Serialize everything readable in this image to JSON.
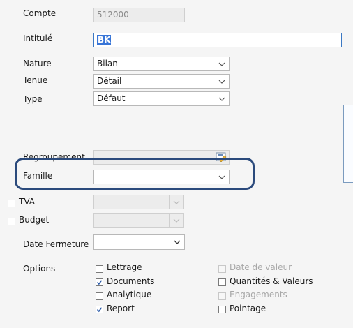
{
  "form": {
    "compte": {
      "label": "Compte",
      "value": "512000"
    },
    "intitule": {
      "label": "Intitulé",
      "value": "BK"
    },
    "nature": {
      "label": "Nature",
      "value": "Bilan"
    },
    "tenue": {
      "label": "Tenue",
      "value": "Détail"
    },
    "type": {
      "label": "Type",
      "value": "Défaut"
    },
    "regroupement": {
      "label": "Regroupement",
      "value": ""
    },
    "famille": {
      "label": "Famille",
      "value": ""
    },
    "tva": {
      "label": "TVA",
      "checked": false,
      "value": ""
    },
    "budget": {
      "label": "Budget",
      "checked": false,
      "value": ""
    },
    "date_fermeture": {
      "label": "Date Fermeture",
      "value": ""
    }
  },
  "options": {
    "label": "Options",
    "items": [
      {
        "label": "Lettrage",
        "checked": false,
        "disabled": false
      },
      {
        "label": "Documents",
        "checked": true,
        "disabled": false
      },
      {
        "label": "Analytique",
        "checked": false,
        "disabled": false
      },
      {
        "label": "Report",
        "checked": true,
        "disabled": false
      },
      {
        "label": "Date de valeur",
        "checked": false,
        "disabled": true
      },
      {
        "label": "Quantités & Valeurs",
        "checked": false,
        "disabled": false
      },
      {
        "label": "Engagements",
        "checked": false,
        "disabled": true
      },
      {
        "label": "Pointage",
        "checked": false,
        "disabled": false
      }
    ]
  },
  "icons": {
    "dropdown": "chevron-down-icon",
    "lookup": "lookup-icon",
    "check": "checkmark-icon"
  },
  "colors": {
    "highlight_frame": "#2b4a7c",
    "selection": "#3875d7",
    "active_border": "#3b78c3"
  }
}
